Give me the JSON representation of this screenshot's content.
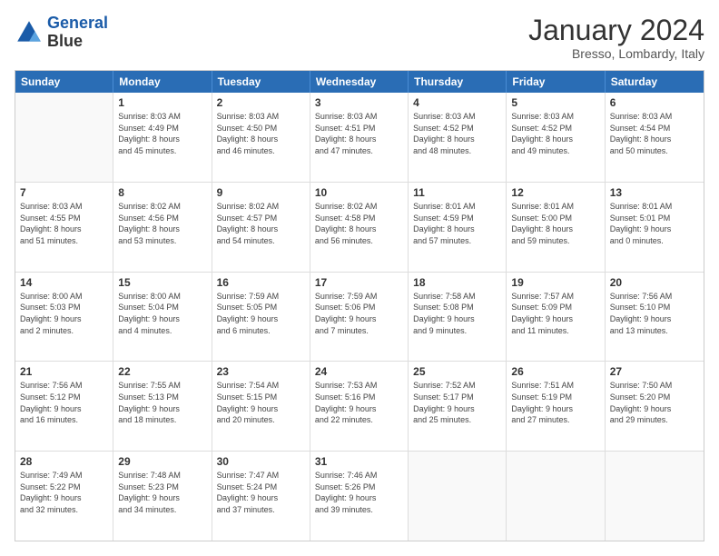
{
  "header": {
    "logo_line1": "General",
    "logo_line2": "Blue",
    "month_title": "January 2024",
    "subtitle": "Bresso, Lombardy, Italy"
  },
  "weekdays": [
    "Sunday",
    "Monday",
    "Tuesday",
    "Wednesday",
    "Thursday",
    "Friday",
    "Saturday"
  ],
  "rows": [
    [
      {
        "day": "",
        "empty": true,
        "lines": []
      },
      {
        "day": "1",
        "lines": [
          "Sunrise: 8:03 AM",
          "Sunset: 4:49 PM",
          "Daylight: 8 hours",
          "and 45 minutes."
        ]
      },
      {
        "day": "2",
        "lines": [
          "Sunrise: 8:03 AM",
          "Sunset: 4:50 PM",
          "Daylight: 8 hours",
          "and 46 minutes."
        ]
      },
      {
        "day": "3",
        "lines": [
          "Sunrise: 8:03 AM",
          "Sunset: 4:51 PM",
          "Daylight: 8 hours",
          "and 47 minutes."
        ]
      },
      {
        "day": "4",
        "lines": [
          "Sunrise: 8:03 AM",
          "Sunset: 4:52 PM",
          "Daylight: 8 hours",
          "and 48 minutes."
        ]
      },
      {
        "day": "5",
        "lines": [
          "Sunrise: 8:03 AM",
          "Sunset: 4:52 PM",
          "Daylight: 8 hours",
          "and 49 minutes."
        ]
      },
      {
        "day": "6",
        "lines": [
          "Sunrise: 8:03 AM",
          "Sunset: 4:54 PM",
          "Daylight: 8 hours",
          "and 50 minutes."
        ]
      }
    ],
    [
      {
        "day": "7",
        "lines": [
          "Sunrise: 8:03 AM",
          "Sunset: 4:55 PM",
          "Daylight: 8 hours",
          "and 51 minutes."
        ]
      },
      {
        "day": "8",
        "lines": [
          "Sunrise: 8:02 AM",
          "Sunset: 4:56 PM",
          "Daylight: 8 hours",
          "and 53 minutes."
        ]
      },
      {
        "day": "9",
        "lines": [
          "Sunrise: 8:02 AM",
          "Sunset: 4:57 PM",
          "Daylight: 8 hours",
          "and 54 minutes."
        ]
      },
      {
        "day": "10",
        "lines": [
          "Sunrise: 8:02 AM",
          "Sunset: 4:58 PM",
          "Daylight: 8 hours",
          "and 56 minutes."
        ]
      },
      {
        "day": "11",
        "lines": [
          "Sunrise: 8:01 AM",
          "Sunset: 4:59 PM",
          "Daylight: 8 hours",
          "and 57 minutes."
        ]
      },
      {
        "day": "12",
        "lines": [
          "Sunrise: 8:01 AM",
          "Sunset: 5:00 PM",
          "Daylight: 8 hours",
          "and 59 minutes."
        ]
      },
      {
        "day": "13",
        "lines": [
          "Sunrise: 8:01 AM",
          "Sunset: 5:01 PM",
          "Daylight: 9 hours",
          "and 0 minutes."
        ]
      }
    ],
    [
      {
        "day": "14",
        "lines": [
          "Sunrise: 8:00 AM",
          "Sunset: 5:03 PM",
          "Daylight: 9 hours",
          "and 2 minutes."
        ]
      },
      {
        "day": "15",
        "lines": [
          "Sunrise: 8:00 AM",
          "Sunset: 5:04 PM",
          "Daylight: 9 hours",
          "and 4 minutes."
        ]
      },
      {
        "day": "16",
        "lines": [
          "Sunrise: 7:59 AM",
          "Sunset: 5:05 PM",
          "Daylight: 9 hours",
          "and 6 minutes."
        ]
      },
      {
        "day": "17",
        "lines": [
          "Sunrise: 7:59 AM",
          "Sunset: 5:06 PM",
          "Daylight: 9 hours",
          "and 7 minutes."
        ]
      },
      {
        "day": "18",
        "lines": [
          "Sunrise: 7:58 AM",
          "Sunset: 5:08 PM",
          "Daylight: 9 hours",
          "and 9 minutes."
        ]
      },
      {
        "day": "19",
        "lines": [
          "Sunrise: 7:57 AM",
          "Sunset: 5:09 PM",
          "Daylight: 9 hours",
          "and 11 minutes."
        ]
      },
      {
        "day": "20",
        "lines": [
          "Sunrise: 7:56 AM",
          "Sunset: 5:10 PM",
          "Daylight: 9 hours",
          "and 13 minutes."
        ]
      }
    ],
    [
      {
        "day": "21",
        "lines": [
          "Sunrise: 7:56 AM",
          "Sunset: 5:12 PM",
          "Daylight: 9 hours",
          "and 16 minutes."
        ]
      },
      {
        "day": "22",
        "lines": [
          "Sunrise: 7:55 AM",
          "Sunset: 5:13 PM",
          "Daylight: 9 hours",
          "and 18 minutes."
        ]
      },
      {
        "day": "23",
        "lines": [
          "Sunrise: 7:54 AM",
          "Sunset: 5:15 PM",
          "Daylight: 9 hours",
          "and 20 minutes."
        ]
      },
      {
        "day": "24",
        "lines": [
          "Sunrise: 7:53 AM",
          "Sunset: 5:16 PM",
          "Daylight: 9 hours",
          "and 22 minutes."
        ]
      },
      {
        "day": "25",
        "lines": [
          "Sunrise: 7:52 AM",
          "Sunset: 5:17 PM",
          "Daylight: 9 hours",
          "and 25 minutes."
        ]
      },
      {
        "day": "26",
        "lines": [
          "Sunrise: 7:51 AM",
          "Sunset: 5:19 PM",
          "Daylight: 9 hours",
          "and 27 minutes."
        ]
      },
      {
        "day": "27",
        "lines": [
          "Sunrise: 7:50 AM",
          "Sunset: 5:20 PM",
          "Daylight: 9 hours",
          "and 29 minutes."
        ]
      }
    ],
    [
      {
        "day": "28",
        "lines": [
          "Sunrise: 7:49 AM",
          "Sunset: 5:22 PM",
          "Daylight: 9 hours",
          "and 32 minutes."
        ]
      },
      {
        "day": "29",
        "lines": [
          "Sunrise: 7:48 AM",
          "Sunset: 5:23 PM",
          "Daylight: 9 hours",
          "and 34 minutes."
        ]
      },
      {
        "day": "30",
        "lines": [
          "Sunrise: 7:47 AM",
          "Sunset: 5:24 PM",
          "Daylight: 9 hours",
          "and 37 minutes."
        ]
      },
      {
        "day": "31",
        "lines": [
          "Sunrise: 7:46 AM",
          "Sunset: 5:26 PM",
          "Daylight: 9 hours",
          "and 39 minutes."
        ]
      },
      {
        "day": "",
        "empty": true,
        "lines": []
      },
      {
        "day": "",
        "empty": true,
        "lines": []
      },
      {
        "day": "",
        "empty": true,
        "lines": []
      }
    ]
  ]
}
